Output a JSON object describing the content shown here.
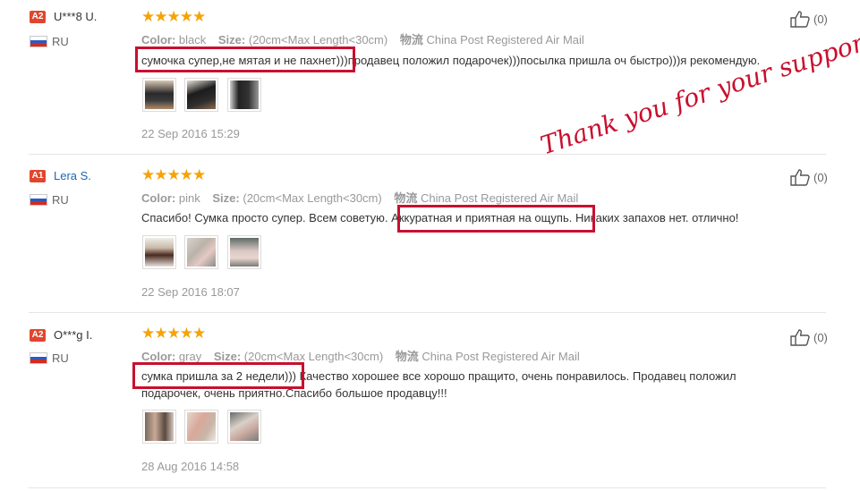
{
  "labels": {
    "color": "Color:",
    "size": "Size:",
    "shipping_icon": "物流"
  },
  "overlay": {
    "thanks": "Thank you for your support!"
  },
  "colors": {
    "star": "#f5a308",
    "highlight": "#c8102e",
    "link": "#1d66b3"
  },
  "reviews": [
    {
      "badge": "A2",
      "badge_color": "#e0462d",
      "name": "U***8 U.",
      "name_is_link": false,
      "country": "RU",
      "rating": 5,
      "stars": "★★★★★",
      "color": "black",
      "size": "(20cm<Max Length<30cm)",
      "shipping": "China Post Registered Air Mail",
      "text": "сумочка супер,не мятая и не пахнет)))продавец положил подарочек)))посылка пришла оч быстро)))я рекомендую.",
      "highlight": "сумочка супер,не мятая и не пахнет)",
      "date": "22 Sep 2016 15:29",
      "likes": "(0)"
    },
    {
      "badge": "A1",
      "badge_color": "#e0462d",
      "name": "Lera S.",
      "name_is_link": true,
      "country": "RU",
      "rating": 5,
      "stars": "★★★★★",
      "color": "pink",
      "size": "(20cm<Max Length<30cm)",
      "shipping": "China Post Registered Air Mail",
      "text": "Спасибо! Сумка просто супер. Всем советую. Аккуратная и приятная на ощупь. Никаких запахов нет. отлично!",
      "highlight": "Аккуратная и приятная на ощупь.",
      "date": "22 Sep 2016 18:07",
      "likes": "(0)"
    },
    {
      "badge": "A2",
      "badge_color": "#e0462d",
      "name": "O***g I.",
      "name_is_link": false,
      "country": "RU",
      "rating": 5,
      "stars": "★★★★★",
      "color": "gray",
      "size": "(20cm<Max Length<30cm)",
      "shipping": "China Post Registered Air Mail",
      "text_line1": "сумка пришла за 2 недели))) Качество хорошее все хорошо пращито, очень понравилось. Продавец положил",
      "text_line2": "подарочек, очень приятно.Спасибо большое продавцу!!!",
      "highlight": "сумка пришла за 2 недели))",
      "date": "28 Aug 2016 14:58",
      "likes": "(0)"
    }
  ]
}
